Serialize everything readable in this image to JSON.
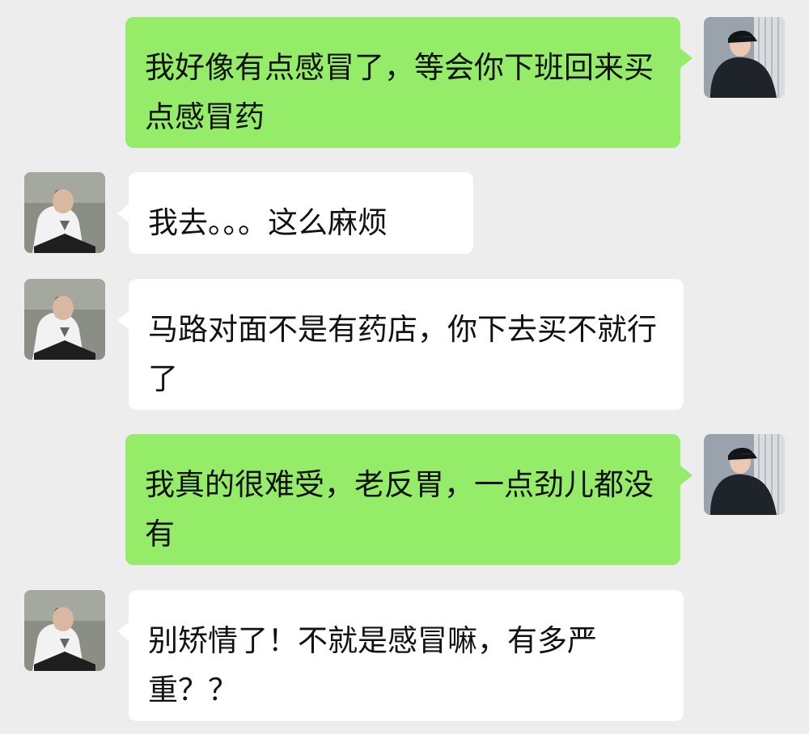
{
  "chat": {
    "messages": [
      {
        "sender": "me",
        "avatar_icon": "user-avatar-icon",
        "text": "我好像有点感冒了，等会你下班回来买点感冒药"
      },
      {
        "sender": "other",
        "avatar_icon": "contact-avatar-icon",
        "text": "我去。。。这么麻烦"
      },
      {
        "sender": "other",
        "avatar_icon": "contact-avatar-icon",
        "text": "马路对面不是有药店，你下去买不就行了"
      },
      {
        "sender": "me",
        "avatar_icon": "user-avatar-icon",
        "text": "我真的很难受，老反胃，一点劲儿都没有"
      },
      {
        "sender": "other",
        "avatar_icon": "contact-avatar-icon",
        "text": "别矫情了！不就是感冒嘛，有多严重？？"
      }
    ],
    "colors": {
      "background": "#ededed",
      "outgoing_bubble": "#95ec69",
      "incoming_bubble": "#ffffff",
      "text": "#111111"
    }
  }
}
